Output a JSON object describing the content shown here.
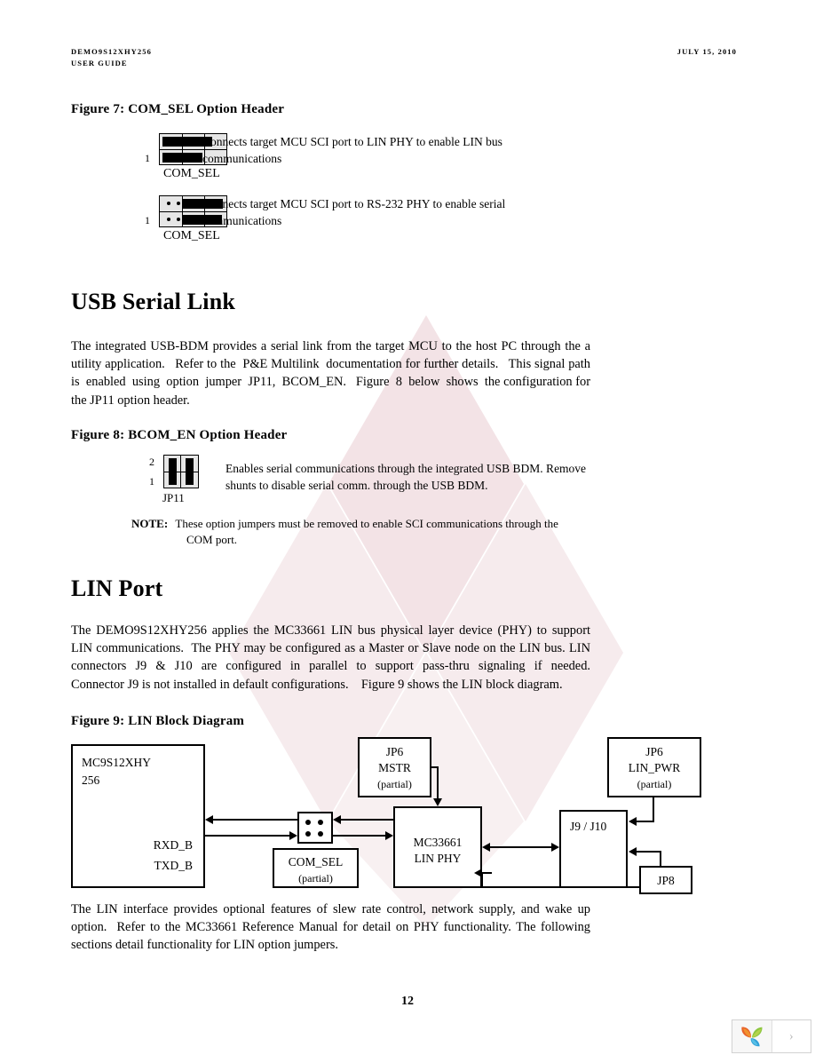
{
  "header": {
    "doc_title_line1": "DEMO9S12XHY256",
    "doc_title_line2": "USER GUIDE",
    "date": "JULY 15, 2010"
  },
  "figure7": {
    "caption": "Figure 7: COM_SEL Option Header",
    "option_a": {
      "pin_label": "1",
      "header_name": "COM_SEL",
      "description": "Connects target MCU SCI port to LIN PHY to enable LIN bus\ncommunications"
    },
    "option_b": {
      "pin_label": "1",
      "header_name": "COM_SEL",
      "description": "Connects target MCU SCI port to RS-232 PHY to enable serial\ncommunications"
    }
  },
  "usb_section": {
    "heading": "USB Serial Link",
    "paragraph": "The integrated USB-BDM provides a serial link from the target MCU to the host PC through the a utility application.   Refer to the  P&E Multilink  documentation for further details.   This signal path  is  enabled  using  option  jumper  JP11,  BCOM_EN.   Figure  8  below  shows  the configuration for the JP11 option header."
  },
  "figure8": {
    "caption": "Figure 8: BCOM_EN Option Header",
    "pin_label_top": "2",
    "pin_label_bottom": "1",
    "header_name": "JP11",
    "description": "Enables serial communications through the integrated USB BDM.  Remove\nshunts to disable serial comm. through the USB BDM.",
    "note_label": "NOTE:",
    "note_text": "These option jumpers must be removed to enable SCI communications through the",
    "note_text2": "COM port."
  },
  "lin_section": {
    "heading": "LIN Port",
    "paragraph": "The DEMO9S12XHY256 applies the MC33661 LIN bus physical layer device (PHY) to support LIN communications.  The PHY may be configured as a Master or Slave node on the LIN bus. LIN  connectors  J9  &  J10  are  configured  in  parallel  to  support  pass-thru  signaling  if  needed. Connector J9 is not installed in default configurations.    Figure 9 shows the LIN block diagram.",
    "closing_paragraph": "The LIN interface provides optional features of slew rate control, network supply, and wake up option.  Refer to the MC33661 Reference Manual for detail on PHY functionality. The following sections detail functionality for LIN option jumpers."
  },
  "figure9": {
    "caption": "Figure 9: LIN Block Diagram",
    "blocks": {
      "mcu": {
        "line1": "MC9S12XHY",
        "line2": "256",
        "pin1": "RXD_B",
        "pin2": "TXD_B"
      },
      "jp6_mstr": {
        "line1": "JP6",
        "line2": "MSTR",
        "line3": "(partial)"
      },
      "jp6_linpwr": {
        "line1": "JP6",
        "line2": "LIN_PWR",
        "line3": "(partial)"
      },
      "comsel": {
        "line1": "COM_SEL",
        "line2": "(partial)"
      },
      "phy": {
        "line1": "MC33661",
        "line2": "LIN PHY"
      },
      "connector": {
        "line1": "J9 / J10"
      },
      "jp8": {
        "line1": "JP8"
      }
    }
  },
  "footer": {
    "page_number": "12"
  },
  "widget": {
    "logo_icon": "leaf-logo-icon",
    "next_icon": "chevron-right-icon",
    "next_glyph": "›"
  },
  "colors": {
    "watermark": "#f3e3e6",
    "jumper_fill": "#e6e6e6",
    "logo_orange": "#e8622a",
    "logo_green": "#8cc63f",
    "logo_blue": "#2f9fd8",
    "widget_border": "#d2d2d2"
  }
}
